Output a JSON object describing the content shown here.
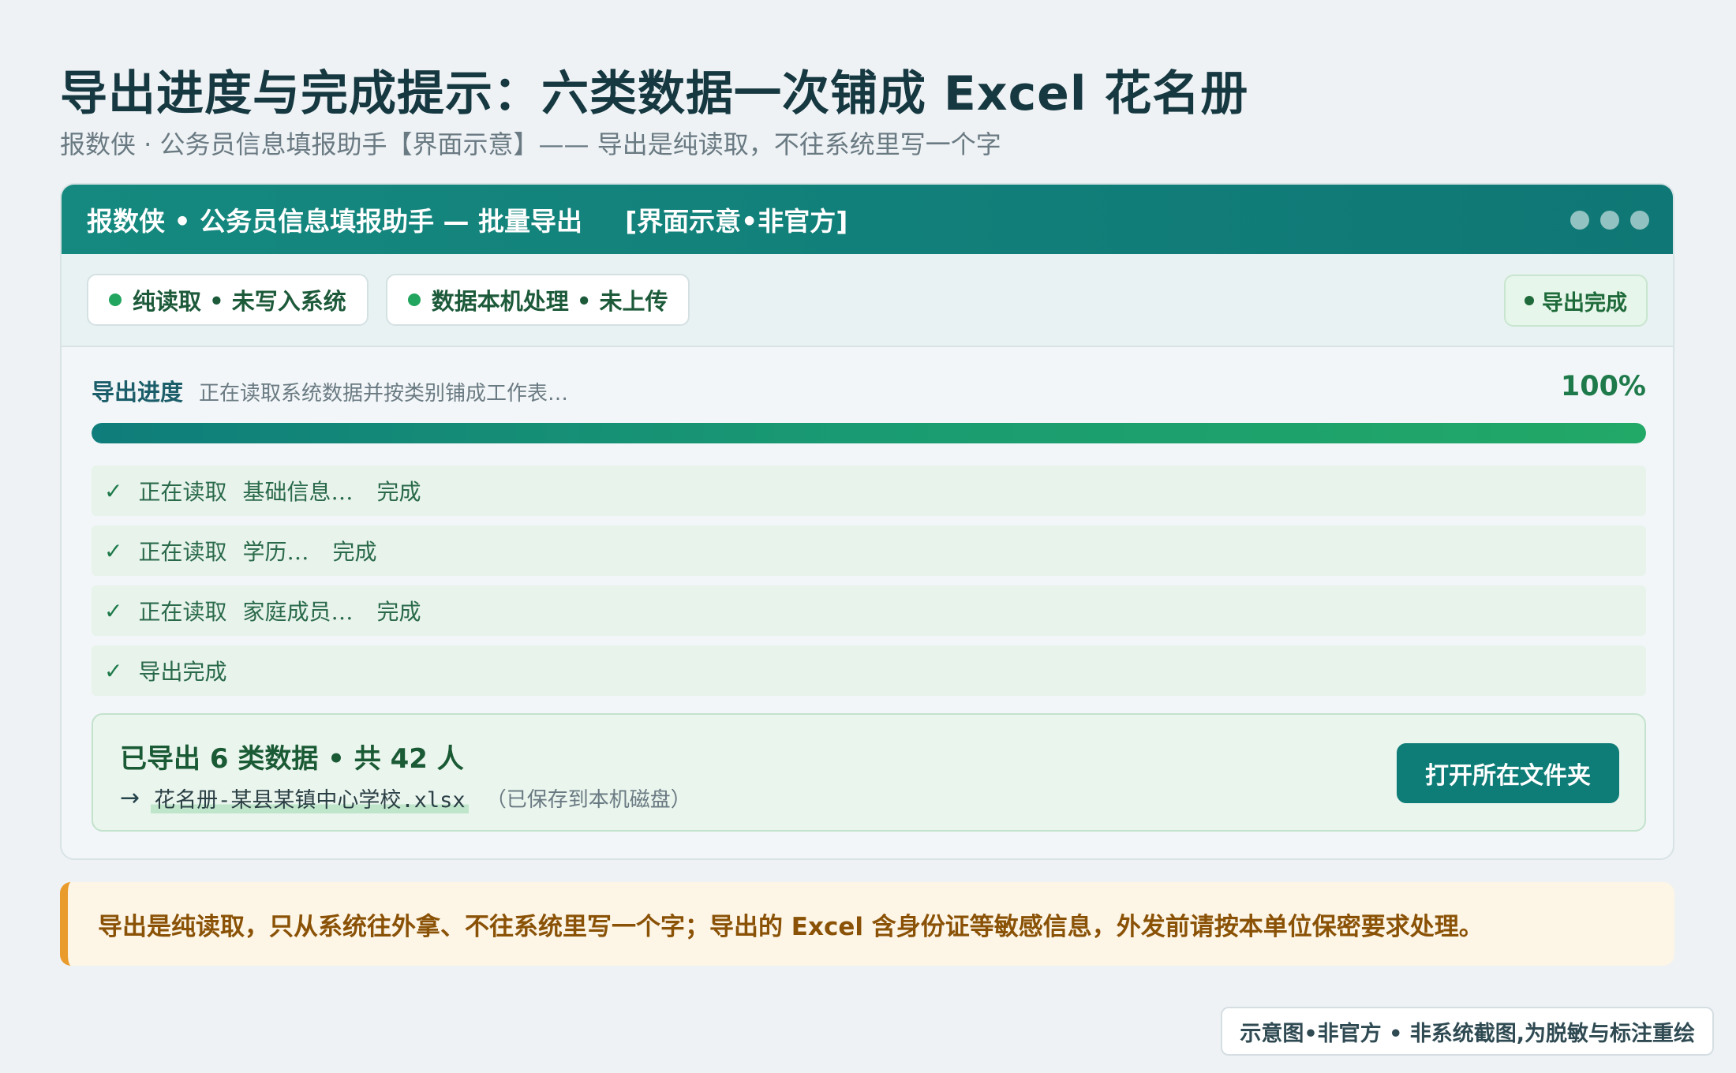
{
  "page": {
    "title": "导出进度与完成提示：六类数据一次铺成 Excel 花名册",
    "subtitle": "报数侠 · 公务员信息填报助手【界面示意】—— 导出是纯读取，不往系统里写一个字"
  },
  "window": {
    "title": "报数侠 • 公务员信息填报助手 — 批量导出",
    "tag": "[界面示意•非官方]"
  },
  "status": {
    "pills": [
      {
        "label": "纯读取 • 未写入系统"
      },
      {
        "label": "数据本机处理 • 未上传"
      }
    ],
    "done_badge": "导出完成"
  },
  "progress": {
    "label": "导出进度",
    "status_text": "正在读取系统数据并按类别铺成工作表…",
    "percent_text": "100%",
    "fraction": 1.0
  },
  "steps": [
    {
      "check": "✓",
      "action": "正在读取",
      "target": "基础信息…",
      "result": "完成"
    },
    {
      "check": "✓",
      "action": "正在读取",
      "target": "学历…",
      "result": "完成"
    },
    {
      "check": "✓",
      "action": "正在读取",
      "target": "家庭成员…",
      "result": "完成"
    },
    {
      "check": "✓",
      "action": "导出完成",
      "target": "",
      "result": ""
    }
  ],
  "result": {
    "summary": "已导出 6 类数据 • 共 42 人",
    "arrow": "→",
    "filename": "花名册-某县某镇中心学校.xlsx",
    "saved_note": "（已保存到本机磁盘）",
    "open_button": "打开所在文件夹"
  },
  "warning": {
    "text": "导出是纯读取，只从系统往外拿、不往系统里写一个字；导出的 Excel 含身份证等敏感信息，外发前请按本单位保密要求处理。"
  },
  "footer": {
    "badge": "示意图•非官方 • 非系统截图,为脱敏与标注重绘"
  },
  "colors": {
    "accent": "#0f7d77",
    "success": "#22a55f",
    "warning": "#e99b2c"
  }
}
